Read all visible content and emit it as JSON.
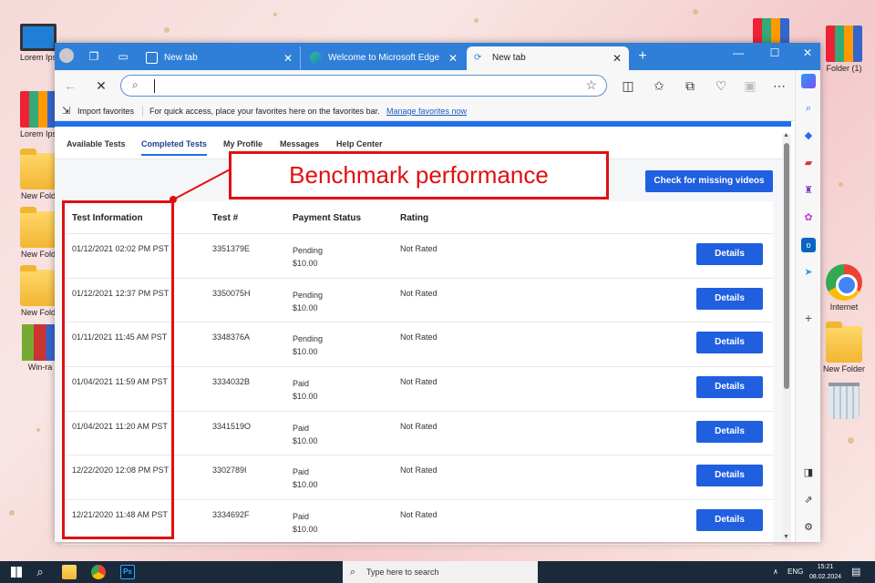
{
  "desktop": {
    "icons": [
      {
        "label": "Lorem Ips"
      },
      {
        "label": "Lorem Ips"
      },
      {
        "label": "New Fold"
      },
      {
        "label": "New Fold"
      },
      {
        "label": "New Fold"
      },
      {
        "label": "Win-ra"
      },
      {
        "label": "Folder (1)"
      },
      {
        "label": "Internet"
      },
      {
        "label": "New Folder"
      }
    ]
  },
  "browser": {
    "tabs": [
      {
        "title": "New tab",
        "icon": "tab-page-icon"
      },
      {
        "title": "Welcome to Microsoft Edge",
        "icon": "edge-icon"
      },
      {
        "title": "New tab",
        "icon": "loading-icon",
        "active": true
      }
    ],
    "new_tab_glyph": "+",
    "window_controls": {
      "minimize": "—",
      "maximize": "☐",
      "close": "✕"
    },
    "address": {
      "value": ""
    },
    "favorites_bar": {
      "import_label": "Import favorites",
      "message": "For quick access, place your favorites here on the favorites bar.",
      "link": "Manage favorites now"
    }
  },
  "page": {
    "nav_tabs": [
      {
        "label": "Available Tests"
      },
      {
        "label": "Completed Tests",
        "active": true
      },
      {
        "label": "My Profile"
      },
      {
        "label": "Messages"
      },
      {
        "label": "Help Center"
      }
    ],
    "check_button": "Check for missing videos",
    "table": {
      "headers": [
        "Test Information",
        "Test #",
        "Payment Status",
        "Rating"
      ],
      "details_label": "Details",
      "rows": [
        {
          "date": "01/12/2021 02:02 PM PST",
          "test": "3351379E",
          "status": "Pending",
          "amount": "$10.00",
          "rating": "Not Rated"
        },
        {
          "date": "01/12/2021 12:37 PM PST",
          "test": "3350075H",
          "status": "Pending",
          "amount": "$10.00",
          "rating": "Not Rated"
        },
        {
          "date": "01/11/2021 11:45 AM PST",
          "test": "3348376A",
          "status": "Pending",
          "amount": "$10.00",
          "rating": "Not Rated"
        },
        {
          "date": "01/04/2021 11:59 AM PST",
          "test": "3334032B",
          "status": "Paid",
          "amount": "$10.00",
          "rating": "Not Rated"
        },
        {
          "date": "01/04/2021 11:20 AM PST",
          "test": "3341519O",
          "status": "Paid",
          "amount": "$10.00",
          "rating": "Not Rated"
        },
        {
          "date": "12/22/2020 12:08 PM PST",
          "test": "3302789I",
          "status": "Paid",
          "amount": "$10.00",
          "rating": "Not Rated"
        },
        {
          "date": "12/21/2020 11:48 AM PST",
          "test": "3334692F",
          "status": "Paid",
          "amount": "$10.00",
          "rating": "Not Rated"
        }
      ]
    }
  },
  "annotation": {
    "label": "Benchmark performance",
    "color": "#e01010"
  },
  "taskbar": {
    "search_placeholder": "Type here to search",
    "language": "ENG",
    "time": "15:21",
    "date": "08.02.2024"
  },
  "colors": {
    "accent": "#1f5fe0",
    "titlebar": "#2f7fd8"
  }
}
